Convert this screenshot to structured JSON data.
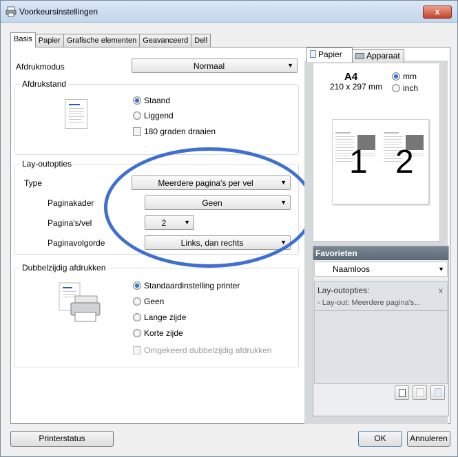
{
  "window": {
    "title": "Voorkeursinstellingen",
    "close_glyph": "x"
  },
  "tabs": [
    {
      "label": "Basis",
      "active": true
    },
    {
      "label": "Papier",
      "active": false
    },
    {
      "label": "Grafische elementen",
      "active": false
    },
    {
      "label": "Geavanceerd",
      "active": false
    },
    {
      "label": "Dell",
      "active": false
    }
  ],
  "print_mode": {
    "label": "Afdrukmodus",
    "value": "Normaal"
  },
  "orientation": {
    "title": "Afdrukstand",
    "options": [
      {
        "label": "Staand",
        "selected": true
      },
      {
        "label": "Liggend",
        "selected": false
      }
    ],
    "rotate_label": "180 graden draaien"
  },
  "layout": {
    "title": "Lay-outopties",
    "type_label": "Type",
    "type_value": "Meerdere pagina's per vel",
    "border_label": "Paginakader",
    "border_value": "Geen",
    "pages_label": "Pagina's/vel",
    "pages_value": "2",
    "order_label": "Paginavolgorde",
    "order_value": "Links, dan rechts"
  },
  "duplex": {
    "title": "Dubbelzijdig afdrukken",
    "options": [
      {
        "label": "Standaardinstelling printer",
        "selected": true
      },
      {
        "label": "Geen",
        "selected": false
      },
      {
        "label": "Lange zijde",
        "selected": false
      },
      {
        "label": "Korte zijde",
        "selected": false
      }
    ],
    "reverse_label": "Omgekeerd dubbelzijdig afdrukken"
  },
  "preview": {
    "tabs": [
      "Papier",
      "Apparaat"
    ],
    "paper": "A4",
    "dimensions": "210 x 297 mm",
    "units": [
      {
        "label": "mm",
        "selected": true
      },
      {
        "label": "inch",
        "selected": false
      }
    ],
    "page_numbers": [
      "1",
      "2"
    ]
  },
  "favorites": {
    "title": "Favorieten",
    "selected": "Naamloos",
    "item_title": "Lay-outopties:",
    "item_close": "x",
    "item_detail": "- Lay-out: Meerdere pagina's,.."
  },
  "buttons": {
    "printer_status": "Printerstatus",
    "ok": "OK",
    "cancel": "Annuleren"
  },
  "colors": {
    "highlight_ellipse": "#3f6fd1",
    "radio_selected": "#1a5cc0",
    "favorites_header": "#66727e"
  }
}
